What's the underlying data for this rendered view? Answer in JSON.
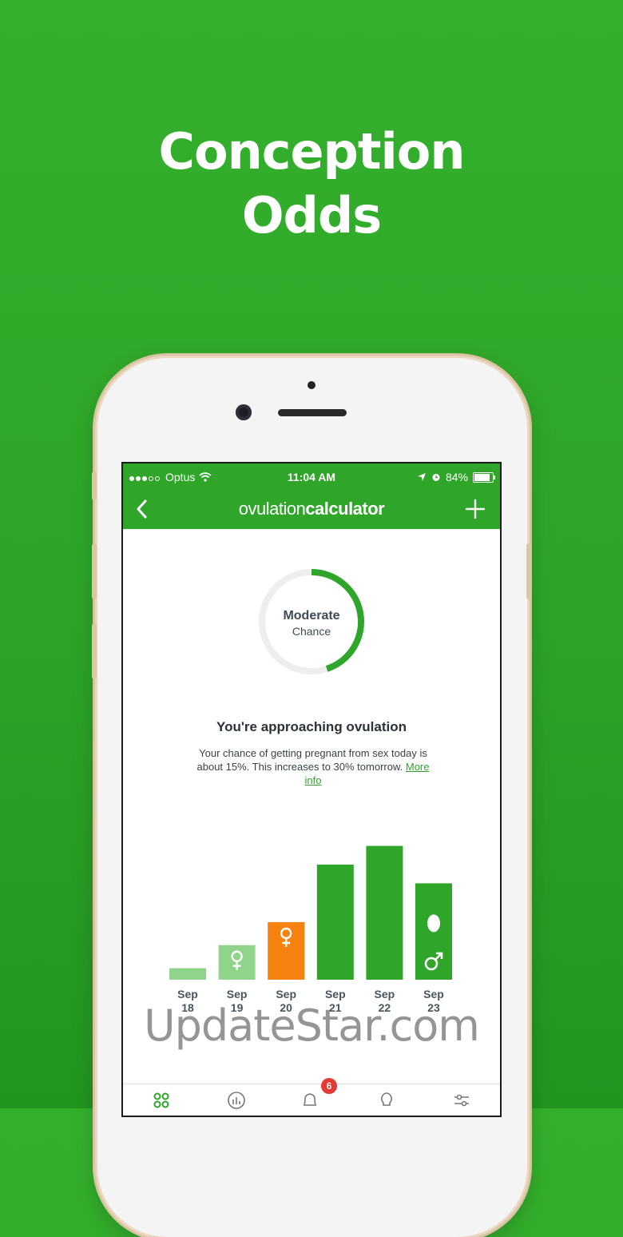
{
  "headline": {
    "line1": "Conception",
    "line2": "Odds"
  },
  "status_bar": {
    "carrier": "Optus",
    "time": "11:04 AM",
    "battery": "84%"
  },
  "nav": {
    "logo_light": "ovulation",
    "logo_bold": "calculator"
  },
  "chance_ring": {
    "label_line1": "Moderate",
    "label_line2": "Chance",
    "fill_fraction": 0.45,
    "color": "#2fa52a",
    "track_color": "#eeeeee"
  },
  "message": {
    "heading": "You're approaching ovulation",
    "body": "Your chance of getting pregnant from sex today is about 15%. This increases to 30% tomorrow.",
    "link": "More info"
  },
  "chart_data": {
    "type": "bar",
    "categories": [
      [
        "Sep",
        "18"
      ],
      [
        "Sep",
        "19"
      ],
      [
        "Sep",
        "20"
      ],
      [
        "Sep",
        "21"
      ],
      [
        "Sep",
        "22"
      ],
      [
        "Sep",
        "23"
      ]
    ],
    "values": [
      8,
      24,
      40,
      80,
      93,
      67
    ],
    "colors": [
      "#8fd48a",
      "#8fd48a",
      "#f5820e",
      "#2fa52a",
      "#2fa52a",
      "#2fa52a"
    ],
    "icons": [
      "",
      "female-icon",
      "female-icon",
      "",
      "",
      "egg-male-icon"
    ],
    "ylim": [
      0,
      100
    ]
  },
  "tabbar": {
    "badge": "6"
  },
  "watermark": "UpdateStar.com"
}
